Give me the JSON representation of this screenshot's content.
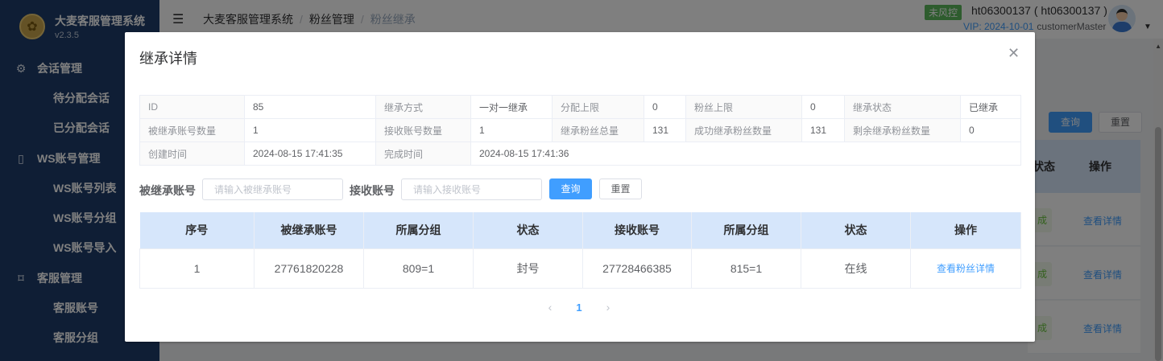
{
  "app": {
    "name": "大麦客服管理系统",
    "version": "v2.3.5"
  },
  "sidebar": {
    "groups": [
      {
        "label": "会话管理",
        "icon": "gear-icon",
        "items": [
          "待分配会话",
          "已分配会话"
        ]
      },
      {
        "label": "WS账号管理",
        "icon": "phone-icon",
        "items": [
          "WS账号列表",
          "WS账号分组",
          "WS账号导入"
        ]
      },
      {
        "label": "客服管理",
        "icon": "bookmark-icon",
        "items": [
          "客服账号",
          "客服分组"
        ]
      }
    ]
  },
  "header": {
    "breadcrumb": [
      "大麦客服管理系统",
      "粉丝管理",
      "粉丝继承"
    ],
    "risk_badge": "未风控",
    "username": "ht06300137 ( ht06300137 )",
    "vip": "VIP: 2024-10-01",
    "role": "customerMaster"
  },
  "background": {
    "query_label": "查询",
    "reset_label": "重置",
    "col_status": "状态",
    "col_action": "操作",
    "row_tag": "成",
    "row_link": "查看详情"
  },
  "dialog": {
    "title": "继承详情",
    "info": [
      [
        {
          "label": "ID",
          "value": "85"
        },
        {
          "label": "继承方式",
          "value": "一对一继承"
        },
        {
          "label": "分配上限",
          "value": "0"
        },
        {
          "label": "粉丝上限",
          "value": "0"
        },
        {
          "label": "继承状态",
          "value": "已继承"
        }
      ],
      [
        {
          "label": "被继承账号数量",
          "value": "1"
        },
        {
          "label": "接收账号数量",
          "value": "1"
        },
        {
          "label": "继承粉丝总量",
          "value": "131"
        },
        {
          "label": "成功继承粉丝数量",
          "value": "131"
        },
        {
          "label": "剩余继承粉丝数量",
          "value": "0"
        }
      ],
      [
        {
          "label": "创建时间",
          "value": "2024-08-15 17:41:35"
        },
        {
          "label": "完成时间",
          "value": "2024-08-15 17:41:36"
        }
      ]
    ],
    "filter": {
      "source_label": "被继承账号",
      "source_placeholder": "请输入被继承账号",
      "source_value": "",
      "target_label": "接收账号",
      "target_placeholder": "请输入接收账号",
      "target_value": "",
      "query_label": "查询",
      "reset_label": "重置"
    },
    "table": {
      "columns": [
        "序号",
        "被继承账号",
        "所属分组",
        "状态",
        "接收账号",
        "所属分组",
        "状态",
        "操作"
      ],
      "rows": [
        {
          "index": "1",
          "source_account": "27761820228",
          "source_group": "809=1",
          "source_status": "封号",
          "target_account": "27728466385",
          "target_group": "815=1",
          "target_status": "在线",
          "action": "查看粉丝详情"
        }
      ]
    },
    "pagination": {
      "prev": "‹",
      "current": "1",
      "next": "›"
    }
  }
}
